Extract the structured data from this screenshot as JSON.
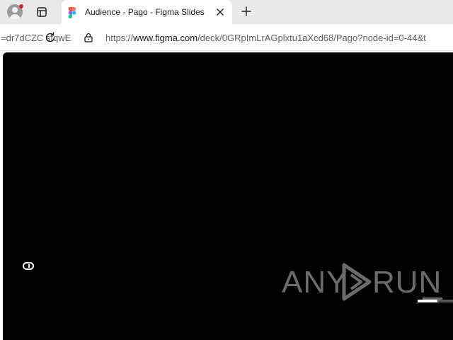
{
  "browser": {
    "profile_icon": "profile-avatar-icon",
    "tab_actions_icon": "tab-actions-icon",
    "active_tab": {
      "title": "Audience - Pago - Figma Slides",
      "favicon": "figma-icon",
      "close_icon": "close-icon"
    },
    "new_tab_icon": "plus-icon",
    "reload_icon": "reload-icon",
    "lock_icon": "lock-icon",
    "url_fragment": "=dr7dCZC  stqwE",
    "url": {
      "prefix": "https://",
      "host": "www.figma.com",
      "path": "/deck/0GRpImLrAGplxtu1aXcd68/Pago?node-id=0-44&t"
    }
  },
  "slide": {
    "background": "#000000",
    "control_icon": "pill-toggle-icon",
    "progress": 0.56
  },
  "watermark": {
    "left": "ANY",
    "right": "RUN",
    "color": "#6b6b6b"
  },
  "colors": {
    "notification_dot": "#d42a1f",
    "figma_red": "#f24e1e",
    "figma_orange": "#ff7262",
    "figma_purple": "#a259ff",
    "figma_blue": "#1abcfe",
    "figma_green": "#0acf83"
  }
}
